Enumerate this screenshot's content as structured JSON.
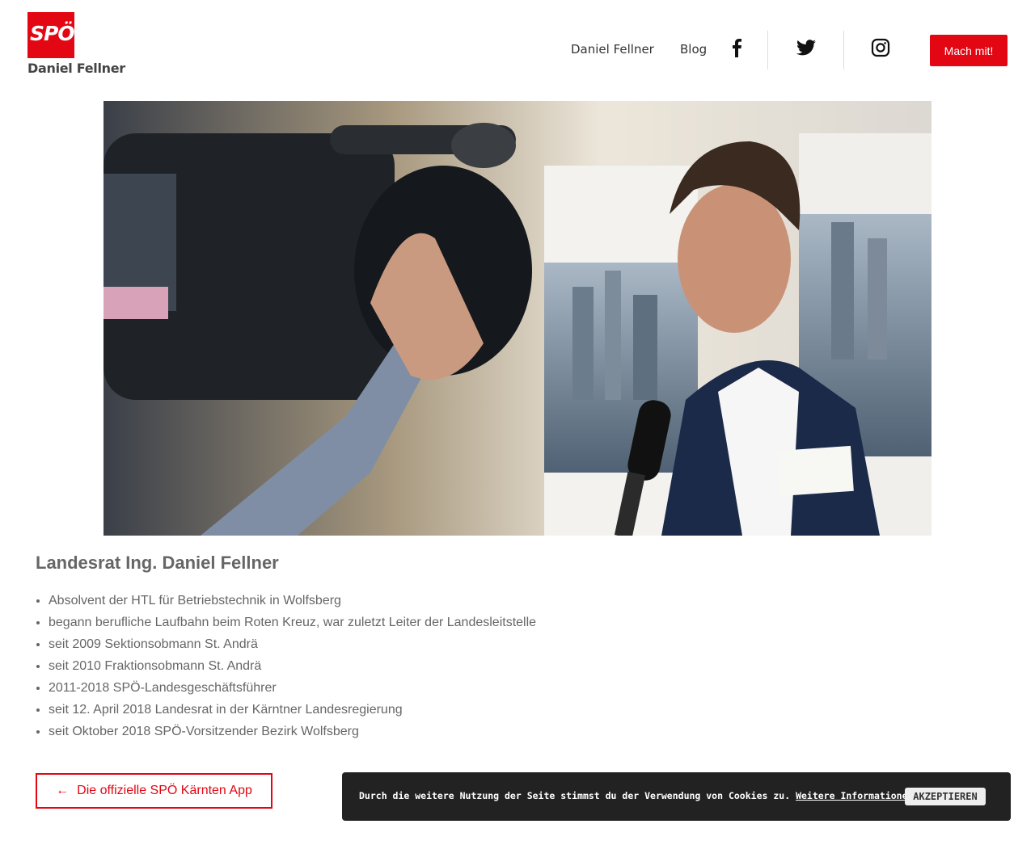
{
  "brand": {
    "logo_text": "SPÖ",
    "name": "Daniel Fellner",
    "accent": "#e30613"
  },
  "nav": {
    "items": [
      {
        "label": "Daniel Fellner"
      },
      {
        "label": "Blog"
      }
    ],
    "social": [
      "facebook-icon",
      "twitter-icon",
      "instagram-icon"
    ],
    "cta_label": "Mach mit!"
  },
  "hero": {
    "image": "interview-photo"
  },
  "main": {
    "title": "Landesrat Ing. Daniel Fellner",
    "bio": [
      "Absolvent der HTL für Betriebstechnik in Wolfsberg",
      "begann berufliche Laufbahn beim Roten Kreuz, war zuletzt Leiter der Landesleitstelle",
      "seit 2009 Sektionsobmann St. Andrä",
      "seit 2010 Fraktionsobmann St. Andrä",
      "2011-2018 SPÖ-Landesgeschäftsführer",
      "seit 12. April 2018 Landesrat in der Kärntner Landesregierung",
      "seit Oktober 2018 SPÖ-Vorsitzender Bezirk Wolfsberg"
    ],
    "app_link": {
      "arrow": "←",
      "label": "Die offizielle SPÖ Kärnten App"
    }
  },
  "cookie": {
    "text": "Durch die weitere Nutzung der Seite stimmst du der Verwendung von Cookies zu.",
    "link": "Weitere Informationen",
    "accept": "AKZEPTIEREN"
  }
}
